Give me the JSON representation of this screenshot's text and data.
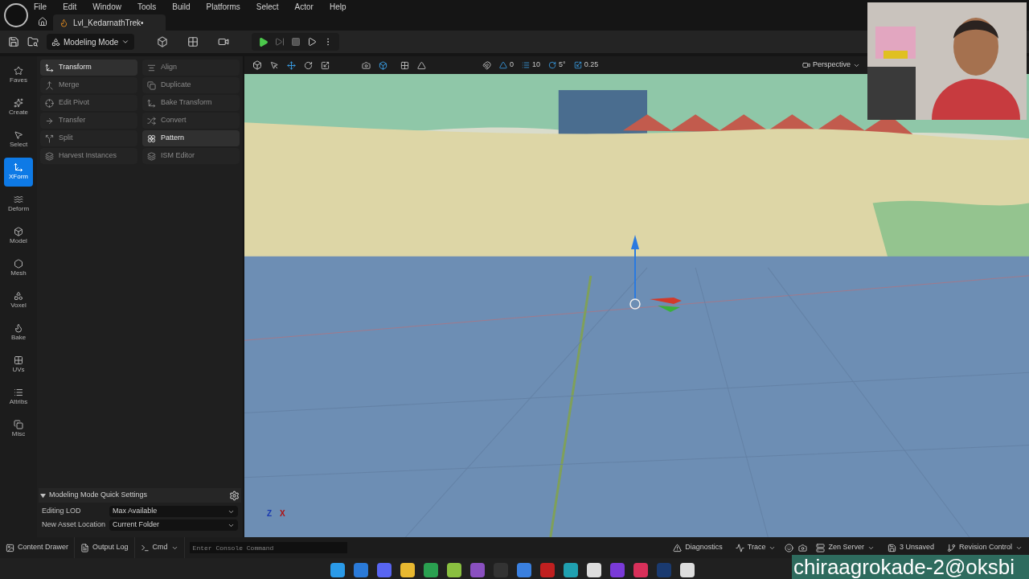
{
  "menu": [
    "File",
    "Edit",
    "Window",
    "Tools",
    "Build",
    "Platforms",
    "Select",
    "Actor",
    "Help"
  ],
  "tab": {
    "title": "Lvl_KedarnathTrek•"
  },
  "toolbar": {
    "mode": "Modeling Mode"
  },
  "mode_bar": [
    {
      "label": "Faves",
      "selected": false
    },
    {
      "label": "Create",
      "selected": false
    },
    {
      "label": "Select",
      "selected": false
    },
    {
      "label": "XForm",
      "selected": true
    },
    {
      "label": "Deform",
      "selected": false
    },
    {
      "label": "Model",
      "selected": false
    },
    {
      "label": "Mesh",
      "selected": false
    },
    {
      "label": "Voxel",
      "selected": false
    },
    {
      "label": "Bake",
      "selected": false
    },
    {
      "label": "UVs",
      "selected": false
    },
    {
      "label": "Attribs",
      "selected": false
    },
    {
      "label": "Misc",
      "selected": false
    }
  ],
  "tools": [
    {
      "label": "Transform",
      "disabled": false
    },
    {
      "label": "Align",
      "disabled": true
    },
    {
      "label": "Merge",
      "disabled": true
    },
    {
      "label": "Duplicate",
      "disabled": true
    },
    {
      "label": "Edit Pivot",
      "disabled": true
    },
    {
      "label": "Bake Transform",
      "disabled": true
    },
    {
      "label": "Transfer",
      "disabled": true
    },
    {
      "label": "Convert",
      "disabled": true
    },
    {
      "label": "Split",
      "disabled": true
    },
    {
      "label": "Pattern",
      "disabled": false
    },
    {
      "label": "Harvest Instances",
      "disabled": true
    },
    {
      "label": "ISM Editor",
      "disabled": true
    }
  ],
  "quick_settings": {
    "title": "Modeling Mode Quick Settings",
    "expanded": true,
    "fields": [
      {
        "label": "Editing LOD",
        "value": "Max Available"
      },
      {
        "label": "New Asset Location",
        "value": "Current Folder"
      }
    ]
  },
  "viewport": {
    "snap_values": [
      "0",
      "10",
      "5°",
      "0.25"
    ],
    "view_mode": "Perspective",
    "axis": {
      "z": "Z",
      "x": "X"
    }
  },
  "status_bar": {
    "left": [
      "Content Drawer",
      "Output Log",
      "Cmd"
    ],
    "console_placeholder": "Enter Console Command",
    "right": [
      "Diagnostics",
      "Trace",
      "Zen Server",
      "3 Unsaved",
      "Revision Control"
    ]
  },
  "overlay": {
    "text": "chiraagrokade-2@oksbi"
  }
}
